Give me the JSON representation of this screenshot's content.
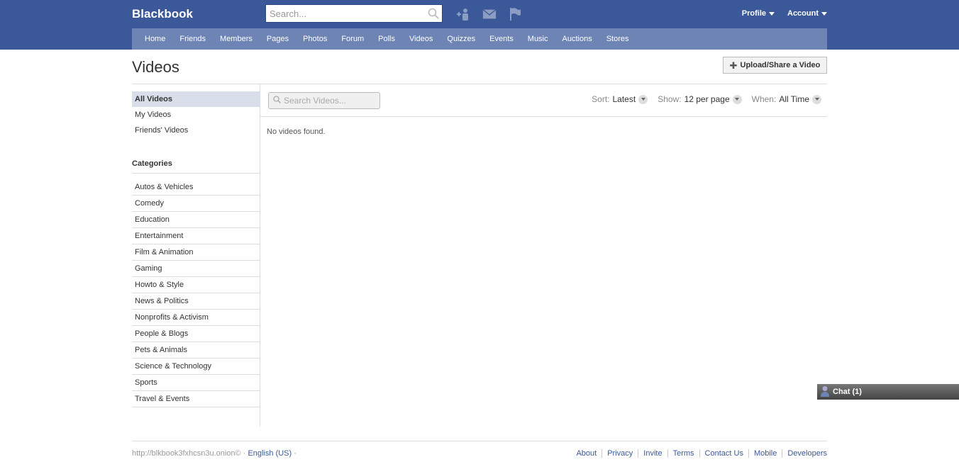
{
  "header": {
    "brand": "Blackbook",
    "search_placeholder": "Search...",
    "icons": [
      "friend-requests-icon",
      "messages-icon",
      "notifications-icon"
    ],
    "profile_label": "Profile",
    "account_label": "Account",
    "bg_color": "#3b5998",
    "nav_color": "#6d84b4"
  },
  "nav": {
    "items": [
      "Home",
      "Friends",
      "Members",
      "Pages",
      "Photos",
      "Forum",
      "Polls",
      "Videos",
      "Quizzes",
      "Events",
      "Music",
      "Auctions",
      "Stores"
    ]
  },
  "main": {
    "title": "Videos",
    "upload_label": "Upload/Share a Video"
  },
  "sidebar": {
    "items": [
      {
        "label": "All Videos",
        "active": true
      },
      {
        "label": "My Videos",
        "active": false
      },
      {
        "label": "Friends' Videos",
        "active": false
      }
    ],
    "categories_heading": "Categories",
    "categories": [
      "Autos & Vehicles",
      "Comedy",
      "Education",
      "Entertainment",
      "Film & Animation",
      "Gaming",
      "Howto & Style",
      "News & Politics",
      "Nonprofits & Activism",
      "People & Blogs",
      "Pets & Animals",
      "Science & Technology",
      "Sports",
      "Travel & Events"
    ]
  },
  "filters": {
    "search_placeholder": "Search Videos...",
    "sort_label": "Sort:",
    "sort_value": "Latest",
    "show_label": "Show:",
    "show_value": "12 per page",
    "when_label": "When:",
    "when_value": "All Time"
  },
  "content": {
    "empty_message": "No videos found."
  },
  "chat": {
    "label": "Chat (1)"
  },
  "footer": {
    "site": "http://blkbook3fxhcsn3u.onion© ·",
    "language": "English (US)",
    "language_suffix": " ·",
    "links": [
      "About",
      "Privacy",
      "Invite",
      "Terms",
      "Contact Us",
      "Mobile",
      "Developers"
    ]
  }
}
